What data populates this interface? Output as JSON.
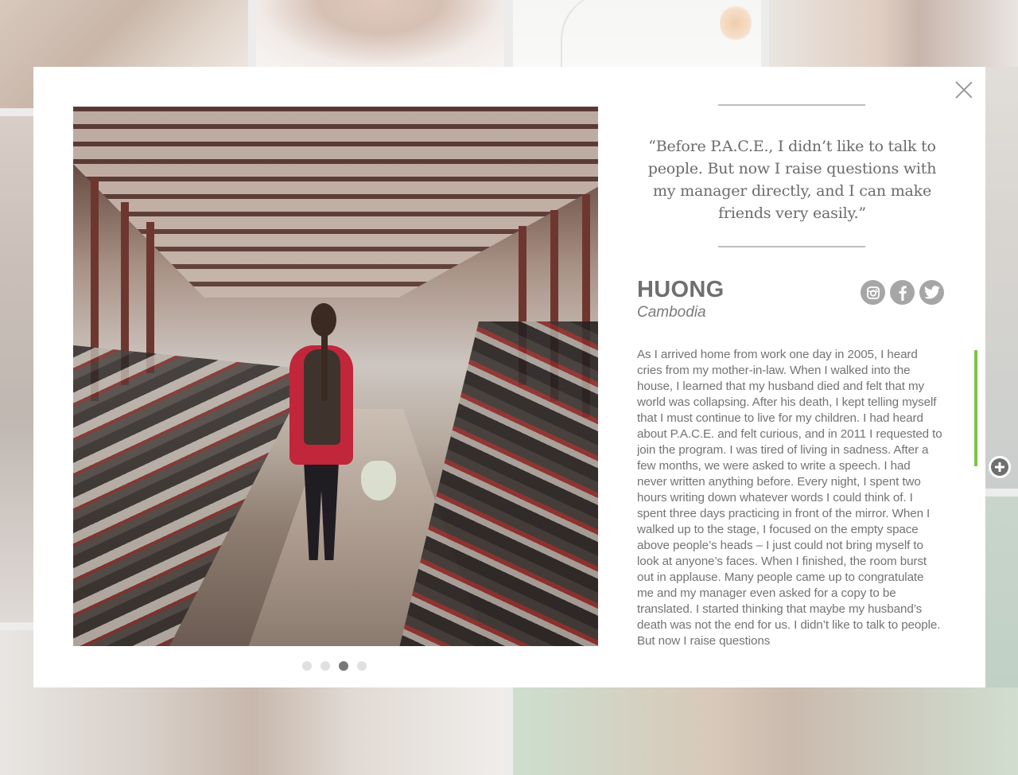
{
  "story": {
    "quote": "“Before P.A.C.E., I didn’t like to talk to people. But now I raise questions with my manager directly, and I can make friends very easily.”",
    "name": "HUONG",
    "country": "Cambodia",
    "body": "As I arrived home from work one day in 2005, I heard cries from my mother-in-law. When I walked into the house, I learned that my husband died and felt that my world was collapsing. After his death, I kept telling myself that I must continue to live for my children. I had heard about P.A.C.E. and felt curious, and in 2011 I requested to join the program. I was tired of living in sadness. After a few months, we were asked to write a speech. I had never written anything before. Every night, I spent two hours writing down whatever words I could think of. I spent three days practicing in front of the mirror. When I walked up to the stage, I focused on the empty space above people’s heads – I just could not bring myself to look at anyone’s faces. When I finished, the room burst out in applause. Many people came up to congratulate me and my manager even asked for a copy to be translated. I started thinking that maybe my husband’s death was not the end for us. I didn’t like to talk to people. But now I raise questions"
  },
  "social": [
    "instagram-icon",
    "facebook-icon",
    "twitter-icon"
  ],
  "carousel": {
    "count": 4,
    "active_index": 2
  },
  "colors": {
    "accent": "#7cc244",
    "text": "#737373",
    "heading": "#6f6f6f",
    "social_bg": "#a6a6a6",
    "dot_inactive": "#e0e0e0",
    "dot_active": "#777777"
  }
}
